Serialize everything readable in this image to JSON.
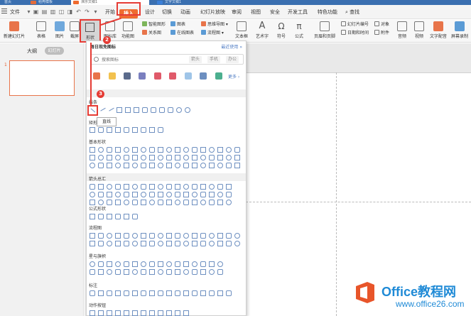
{
  "window": {
    "tabs": [
      {
        "label": "首页",
        "active": false
      },
      {
        "label": "稻壳模板",
        "active": false
      },
      {
        "label": "演示文稿1",
        "active": true
      },
      {
        "label": "文字文稿1",
        "active": false
      }
    ]
  },
  "menubar": {
    "file_label": "文件",
    "items": [
      "开始",
      "插入",
      "设计",
      "切换",
      "动画",
      "幻灯片放映",
      "审阅",
      "视图",
      "安全",
      "开发工具",
      "特色功能"
    ],
    "active_item": "插入",
    "search_label": "查找"
  },
  "ribbon": {
    "new_slide": "新建幻灯片",
    "table": "表格",
    "picture": "图片",
    "screenshot": "截屏",
    "shape": "形状",
    "icon_lib": "图标库",
    "function_chart": "功能图",
    "smartart": "智能图形",
    "chart": "图表",
    "relation_chart": "关系图",
    "online_chart": "在线图表",
    "mindmap": "思维导图",
    "flowchart": "流程图",
    "textbox": "文本框",
    "wordart": "艺术字",
    "symbol": "符号",
    "formula": "公式",
    "header_footer": "页眉和页脚",
    "slide_number": "幻灯片编号",
    "object": "对象",
    "datetime": "日期和时间",
    "attachment": "附件",
    "audio": "音频",
    "video": "视频",
    "text_to_speech": "文字配音",
    "screen_record": "屏幕录制"
  },
  "left_pane": {
    "outline_tab": "大纲",
    "slides_tab": "幻灯片",
    "slide_number": "1"
  },
  "shape_panel": {
    "title": "每日现免图标",
    "recent_link": "最近使用",
    "search_placeholder": "搜索图标",
    "search_tags": [
      "箭头",
      "手机",
      "办公"
    ],
    "more_link": "更多",
    "sections": {
      "line": "线条",
      "rect": "矩形",
      "basic": "基本形状",
      "arrows": "箭头总汇",
      "formula": "公式形状",
      "flowchart": "流程图",
      "stars": "星与旗帜",
      "callouts": "标注",
      "action": "动作按钮"
    },
    "tooltip": "直线"
  },
  "annotations": {
    "step1": "1",
    "step2": "2",
    "step3": "3",
    "color": "#e53b34"
  },
  "watermark": {
    "title": "Office教程网",
    "url": "www.office26.com"
  },
  "colors": {
    "accent": "#ef6b2f",
    "link": "#4f7cc4",
    "shape_stroke": "#6d8fc0"
  }
}
